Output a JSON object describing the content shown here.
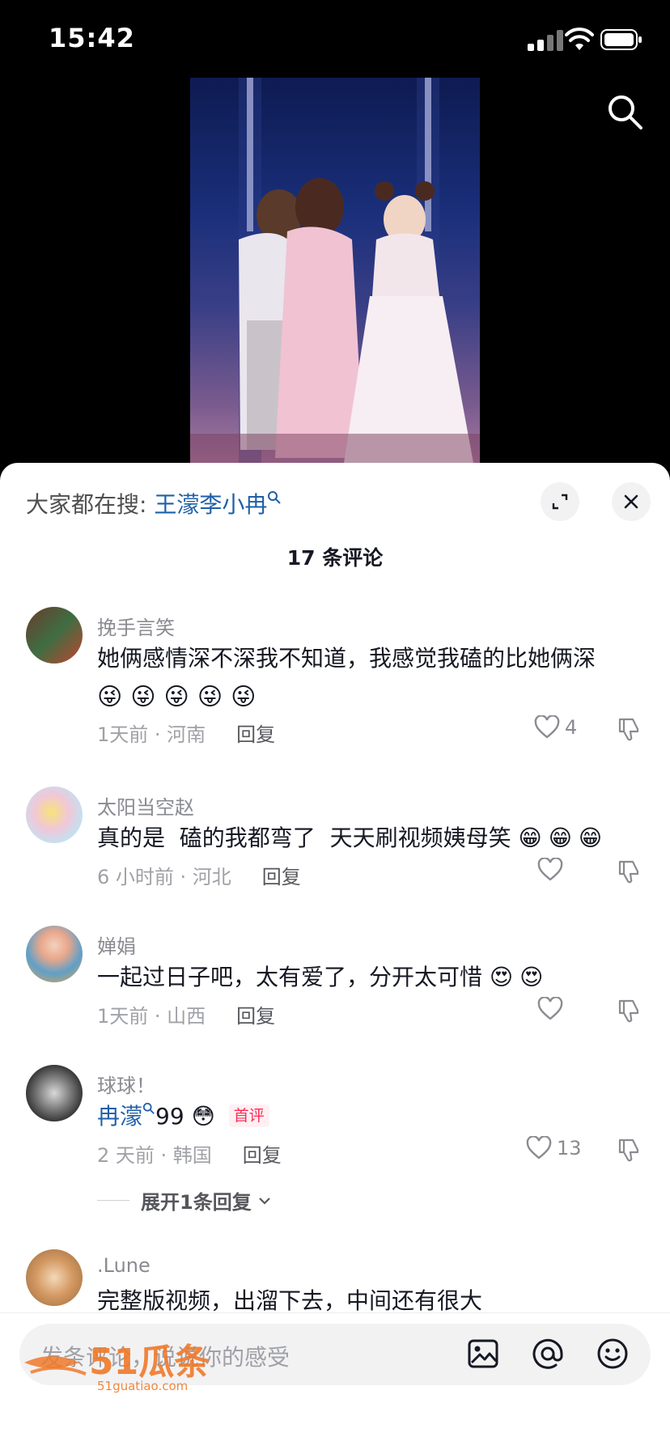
{
  "status_bar": {
    "time": "15:42"
  },
  "video": {
    "search_icon": "search-icon"
  },
  "sheet": {
    "search_hint_prefix": "大家都在搜: ",
    "search_hint_keyword": "王濛李小冉",
    "comment_count": "17 条评论",
    "colors": {
      "link": "#1f5fa8",
      "badge": "#fe2c55"
    },
    "comments": [
      {
        "username": "挽手言笑",
        "text": "她俩感情深不深我不知道，我感觉我磕的比她俩深",
        "emojis": "😜😜😜😜😜",
        "meta": "1天前 · 河南",
        "reply": "回复",
        "likes": "4"
      },
      {
        "username": "太阳当空赵",
        "text": "真的是  磕的我都弯了  天天刷视频姨母笑",
        "emojis": "😁😁😁",
        "meta": "6 小时前 · 河北",
        "reply": "回复",
        "likes": ""
      },
      {
        "username": "婵娟",
        "text": "一起过日子吧，太有爱了，分开太可惜",
        "emojis": "😍😍",
        "meta": "1天前 · 山西",
        "reply": "回复",
        "likes": ""
      },
      {
        "username": "球球！",
        "text_link": "冉濛",
        "text": "99",
        "emojis": "😳",
        "badge": "首评",
        "meta": "2 天前 · 韩国",
        "reply": "回复",
        "likes": "13",
        "expand_replies": "展开1条回复"
      },
      {
        "username": ".Lune",
        "text": "完整版视频，出溜下去，中间还有很大"
      }
    ],
    "input_placeholder": "发条评论，说说你的感受",
    "watermark": {
      "brand": "51瓜条",
      "url": "51guatiao.com"
    }
  }
}
